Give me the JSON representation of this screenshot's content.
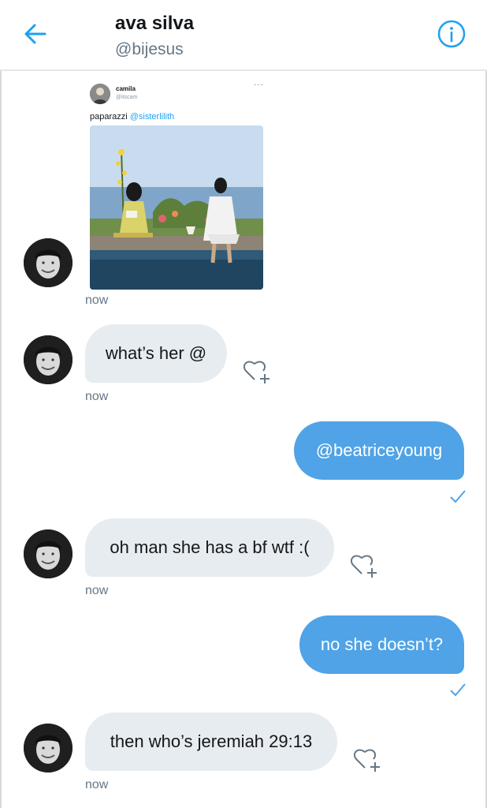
{
  "header": {
    "title": "ava silva",
    "handle": "@bijesus"
  },
  "shared_tweet": {
    "name": "camila",
    "handle": "@itscam",
    "more": "···",
    "text": "paparazzi ",
    "mention": "@sisterlilith",
    "timestamp": "now"
  },
  "messages": [
    {
      "text": "what’s her @",
      "timestamp": "now"
    },
    {
      "text": "@beatriceyoung"
    },
    {
      "text": "oh man she has a bf wtf :(",
      "timestamp": "now"
    },
    {
      "text": "no she doesn’t?"
    },
    {
      "text": "then who’s jeremiah 29:13",
      "timestamp": "now"
    }
  ],
  "colors": {
    "accent": "#1da1f2",
    "outgoing_bubble": "#4fa3e6",
    "incoming_bubble": "#e6ecf0"
  }
}
